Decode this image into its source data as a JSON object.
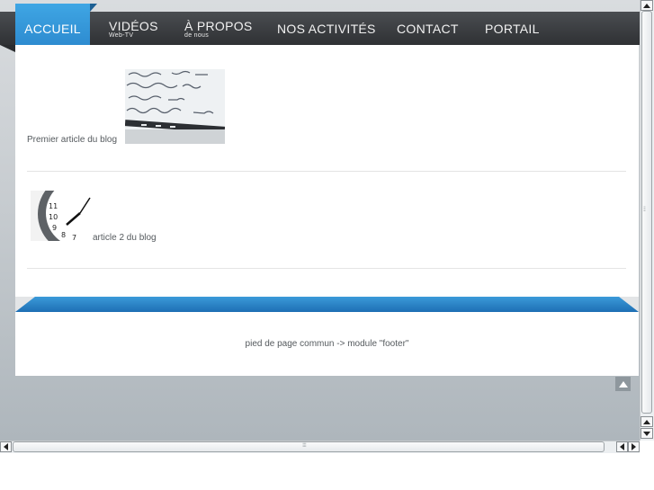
{
  "nav": {
    "active": "ACCUEIL",
    "items": [
      {
        "label": "VIDÉOS",
        "sub": "Web-TV"
      },
      {
        "label": "À PROPOS",
        "sub": "de nous"
      },
      {
        "label": "NOS ACTIVITÉS",
        "sub": ""
      },
      {
        "label": "CONTACT",
        "sub": ""
      },
      {
        "label": "PORTAIL",
        "sub": ""
      }
    ]
  },
  "articles": [
    {
      "title": "Premier article du blog"
    },
    {
      "title": "article 2 du blog"
    }
  ],
  "footer": {
    "text": "pied de page commun -> module \"footer\""
  },
  "colors": {
    "accent": "#2a86cc",
    "navbar": "#3a3c40",
    "band": "#2c86c9"
  },
  "icons": {
    "totop": "arrow-up-icon"
  }
}
